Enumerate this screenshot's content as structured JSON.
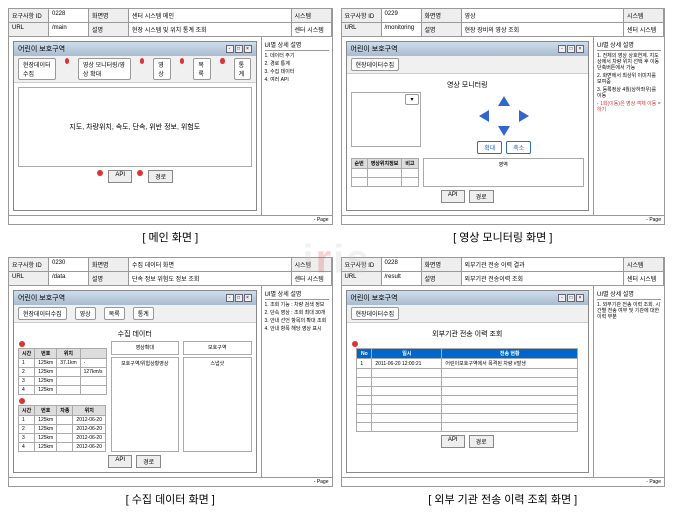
{
  "watermark": {
    "i": "i",
    "r": "r",
    "is": "is"
  },
  "common": {
    "req_id_label": "요구사항 ID",
    "url_label": "URL",
    "screen_label": "화면명",
    "desc_label": "설명",
    "system_label": "시스템",
    "notes_header": "UI별 상세 설명",
    "page_label": "- Page",
    "app_title": "어린이 보호구역"
  },
  "screens": [
    {
      "req_id": "0228",
      "url_val": "/main",
      "screen_name": "센터 시스템 메인",
      "desc": "현장 시스템 및 위치 통계 조회",
      "system": "센터 시스템",
      "caption": "[ 메인 화면 ]",
      "tabs": [
        "현장데이터수집",
        "영상 모니터링/영상 확대",
        "영상",
        "목록",
        "통계"
      ],
      "notes": [
        {
          "n": "1.",
          "t": "데이터 주기"
        },
        {
          "n": "2.",
          "t": "경로 통계"
        },
        {
          "n": "3.",
          "t": "수집 데이터"
        },
        {
          "n": "4.",
          "t": "여러 API"
        }
      ],
      "bigbox_text": "지도, 차량위치, 속도, 단속, 위반 정보, 위험도",
      "footer": [
        "API",
        "경로"
      ]
    },
    {
      "req_id": "0229",
      "url_val": "/monitoring",
      "screen_name": "영상",
      "desc": "현장 장비의 영상 조회",
      "system": "센터 시스템",
      "caption": "[ 영상 모니터링 화면 ]",
      "tabs": [
        "현장데이터수집"
      ],
      "subtitle": "영상 모니터링",
      "notes": [
        {
          "n": "1.",
          "t": "전체의 영상 상호연계. 지도 상에서 차량 위치 선택 후 이동 단축버튼에서 가능"
        },
        {
          "n": "2.",
          "t": "화면에서 최상위 이미지를 보여줌"
        },
        {
          "n": "3.",
          "t": "등록정상 4월(상하좌우)를 이동"
        },
        {
          "n": "-",
          "t": "1회(이동)은 영상 객체 이동 = 하기",
          "warn": true
        }
      ],
      "ctrlbtns": [
        "확대",
        "축소"
      ],
      "mini_headers": [
        "순번",
        "영상위치정보",
        "비고"
      ],
      "mini_rows": [
        [
          "",
          "",
          ""
        ],
        [
          "",
          "",
          ""
        ]
      ],
      "side_label": "영역",
      "footer": [
        "API",
        "경로"
      ]
    },
    {
      "req_id": "0230",
      "url_val": "/data",
      "screen_name": "수집 데이터 화면",
      "desc": "단속 정보 위험도 정보 조회",
      "system": "센터 시스템",
      "caption": "[ 수집 데이터 화면 ]",
      "tabs": [
        "현장데이터수집",
        "영상",
        "목록",
        "통계"
      ],
      "subtitle": "수집 데이터",
      "notes": [
        {
          "n": "1.",
          "t": "조회 기능 : 차량 검색 정보"
        },
        {
          "n": "2.",
          "t": "단속 영상 : 조회 최대 30개"
        },
        {
          "n": "3.",
          "t": "안내 선언 항목의 확대 조회"
        },
        {
          "n": "4.",
          "t": "안내 항목 해당 영상 표시"
        }
      ],
      "table1_h": [
        "시간",
        "번호",
        "위치"
      ],
      "table1": [
        [
          "1",
          "125km",
          "37.1km",
          "-"
        ],
        [
          "2",
          "125km",
          "",
          "127km/s"
        ],
        [
          "3",
          "125km",
          "",
          "-"
        ],
        [
          "4",
          "125km",
          "",
          "-"
        ]
      ],
      "table2_h": [
        "시간",
        "번호",
        "차종",
        "위치"
      ],
      "table2": [
        [
          "1",
          "125km",
          "",
          "2012-06-20"
        ],
        [
          "2",
          "125km",
          "",
          "2012-06-20"
        ],
        [
          "3",
          "125km",
          "",
          "2012-06-20"
        ],
        [
          "4",
          "125km",
          "",
          "2012-06-20"
        ]
      ],
      "panels": [
        "영상확대",
        "보호구역",
        "보호구역/위험상황영상",
        "스냅샷"
      ],
      "footer": [
        "API",
        "경로"
      ]
    },
    {
      "req_id": "0228",
      "url_val": "/result",
      "screen_name": "외부기관 전송 이력 결과",
      "desc": "외부기관 전송이력 조회",
      "system": "센터 시스템",
      "caption": "[ 외부 기관 전송 이력 조회 화면 ]",
      "tabs": [
        "현장데이터수집"
      ],
      "subtitle": "외부기관 전송 이력 조회",
      "notes": [
        {
          "n": "1.",
          "t": "외부기관 전송 이력 조회. 시간별 전송 여부 및 기관에 대한 이력 부분"
        }
      ],
      "th": [
        "No",
        "일시",
        "전송 현황"
      ],
      "rows": [
        [
          "1",
          "2011-06-20 12:00:21",
          "어린이보호구역에서 목격된 차량 #발생"
        ],
        [
          "",
          "",
          ""
        ],
        [
          "",
          "",
          ""
        ],
        [
          "",
          "",
          ""
        ],
        [
          "",
          "",
          ""
        ],
        [
          "",
          "",
          ""
        ],
        [
          "",
          "",
          ""
        ],
        [
          "",
          "",
          ""
        ]
      ],
      "footer": [
        "API",
        "경로"
      ]
    }
  ]
}
